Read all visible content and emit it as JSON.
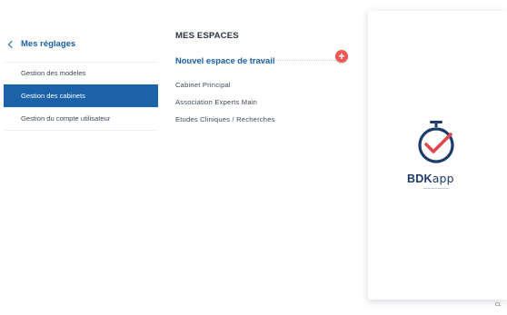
{
  "settings": {
    "back_label": "Mes réglages",
    "menu": [
      {
        "label": "Gestion des modeles",
        "active": false
      },
      {
        "label": "Gestion des cabinets",
        "active": true
      },
      {
        "label": "Gestion du compte utilisateur",
        "active": false
      }
    ]
  },
  "spaces": {
    "title": "MES ESPACES",
    "new_label": "Nouvel espace de travail",
    "add_icon": "+",
    "items": [
      "Cabinet Principal",
      "Association Experts Main",
      "Etudes Cliniques / Recherches"
    ]
  },
  "brand": {
    "name_bold": "BDK",
    "name_light": "app",
    "corner_mark": "CL"
  },
  "colors": {
    "accent": "#1b62a8",
    "add_button": "#ee5a55",
    "logo_navy": "#1e3a66",
    "check_red": "#e0474c"
  },
  "icons": [
    "chevron-left-icon",
    "plus-icon",
    "stopwatch-check-logo"
  ]
}
